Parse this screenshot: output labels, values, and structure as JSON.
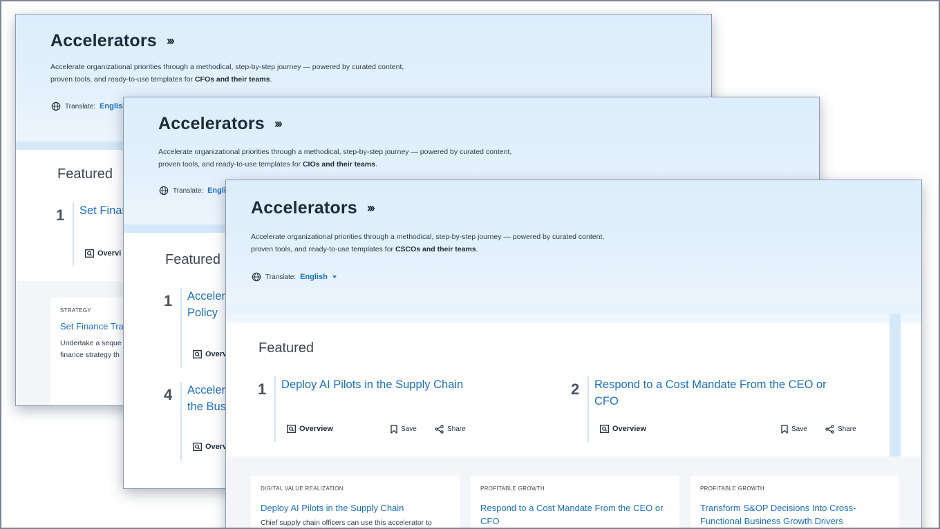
{
  "cards": [
    {
      "title": "Accelerators",
      "chevrons": "›››",
      "desc_before": "Accelerate organizational priorities through a methodical, step-by-step journey — powered by curated content, proven tools, and ready-to-use templates for ",
      "audience": "CFOs and their teams",
      "desc_after": ".",
      "translate_label": "Translate:",
      "language": "English",
      "featured_title": "Featured",
      "featured": [
        {
          "num": "1",
          "title": "Set Finan"
        }
      ],
      "overview": "Overvi",
      "tile": {
        "category": "STRATEGY",
        "title": "Set Finance Tra",
        "desc_l1": "Undertake a seque",
        "desc_l2": "finance strategy th"
      }
    },
    {
      "title": "Accelerators",
      "chevrons": "›››",
      "desc_before": "Accelerate organizational priorities through a methodical, step-by-step journey — powered by curated content, proven tools, and ready-to-use templates for ",
      "audience": "CIOs and their teams",
      "desc_after": ".",
      "translate_label": "Translate:",
      "language": "Englis",
      "featured_title": "Featured",
      "featured": [
        {
          "num": "1",
          "title_l1": "Acceler",
          "title_l2": "Policy"
        },
        {
          "num": "4",
          "title_l1": "Acceler",
          "title_l2": "the Bus"
        }
      ],
      "overview": "Overv",
      "overview2": "Overv"
    },
    {
      "title": "Accelerators",
      "chevrons": "›››",
      "desc_before": "Accelerate organizational priorities through a methodical, step-by-step journey — powered by curated content, proven tools, and ready-to-use templates for ",
      "audience": "CSCOs and their teams",
      "desc_after": ".",
      "translate_label": "Translate:",
      "language": "English",
      "featured_title": "Featured",
      "featured": [
        {
          "num": "1",
          "title_l1": "Deploy AI Pilots in the Supply Chain",
          "title_l2": "",
          "overview": "Overview",
          "save": "Save",
          "share": "Share"
        },
        {
          "num": "2",
          "title_l1": "Respond to a Cost Mandate From the CEO or",
          "title_l2": "CFO",
          "overview": "Overview",
          "save": "Save",
          "share": "Share"
        }
      ],
      "tiles": [
        {
          "category": "DIGITAL VALUE REALIZATION",
          "title_l1": "Deploy AI Pilots in the Supply Chain",
          "title_l2": "",
          "desc": "Chief supply chain officers can use this accelerator to"
        },
        {
          "category": "PROFITABLE GROWTH",
          "title_l1": "Respond to a Cost Mandate From the CEO or",
          "title_l2": "CFO",
          "desc": ""
        },
        {
          "category": "PROFITABLE GROWTH",
          "title_l1": "Transform S&OP Decisions Into Cross-",
          "title_l2": "Functional Business Growth Drivers",
          "desc": ""
        }
      ]
    }
  ],
  "colors": {
    "link": "#1a6fc4",
    "hero": "#dcedfb",
    "text": "#1f2a37"
  },
  "icons": [
    "chevrons-right-icon",
    "globe-icon",
    "caret-down-icon",
    "overview-icon",
    "bookmark-icon",
    "share-icon"
  ]
}
